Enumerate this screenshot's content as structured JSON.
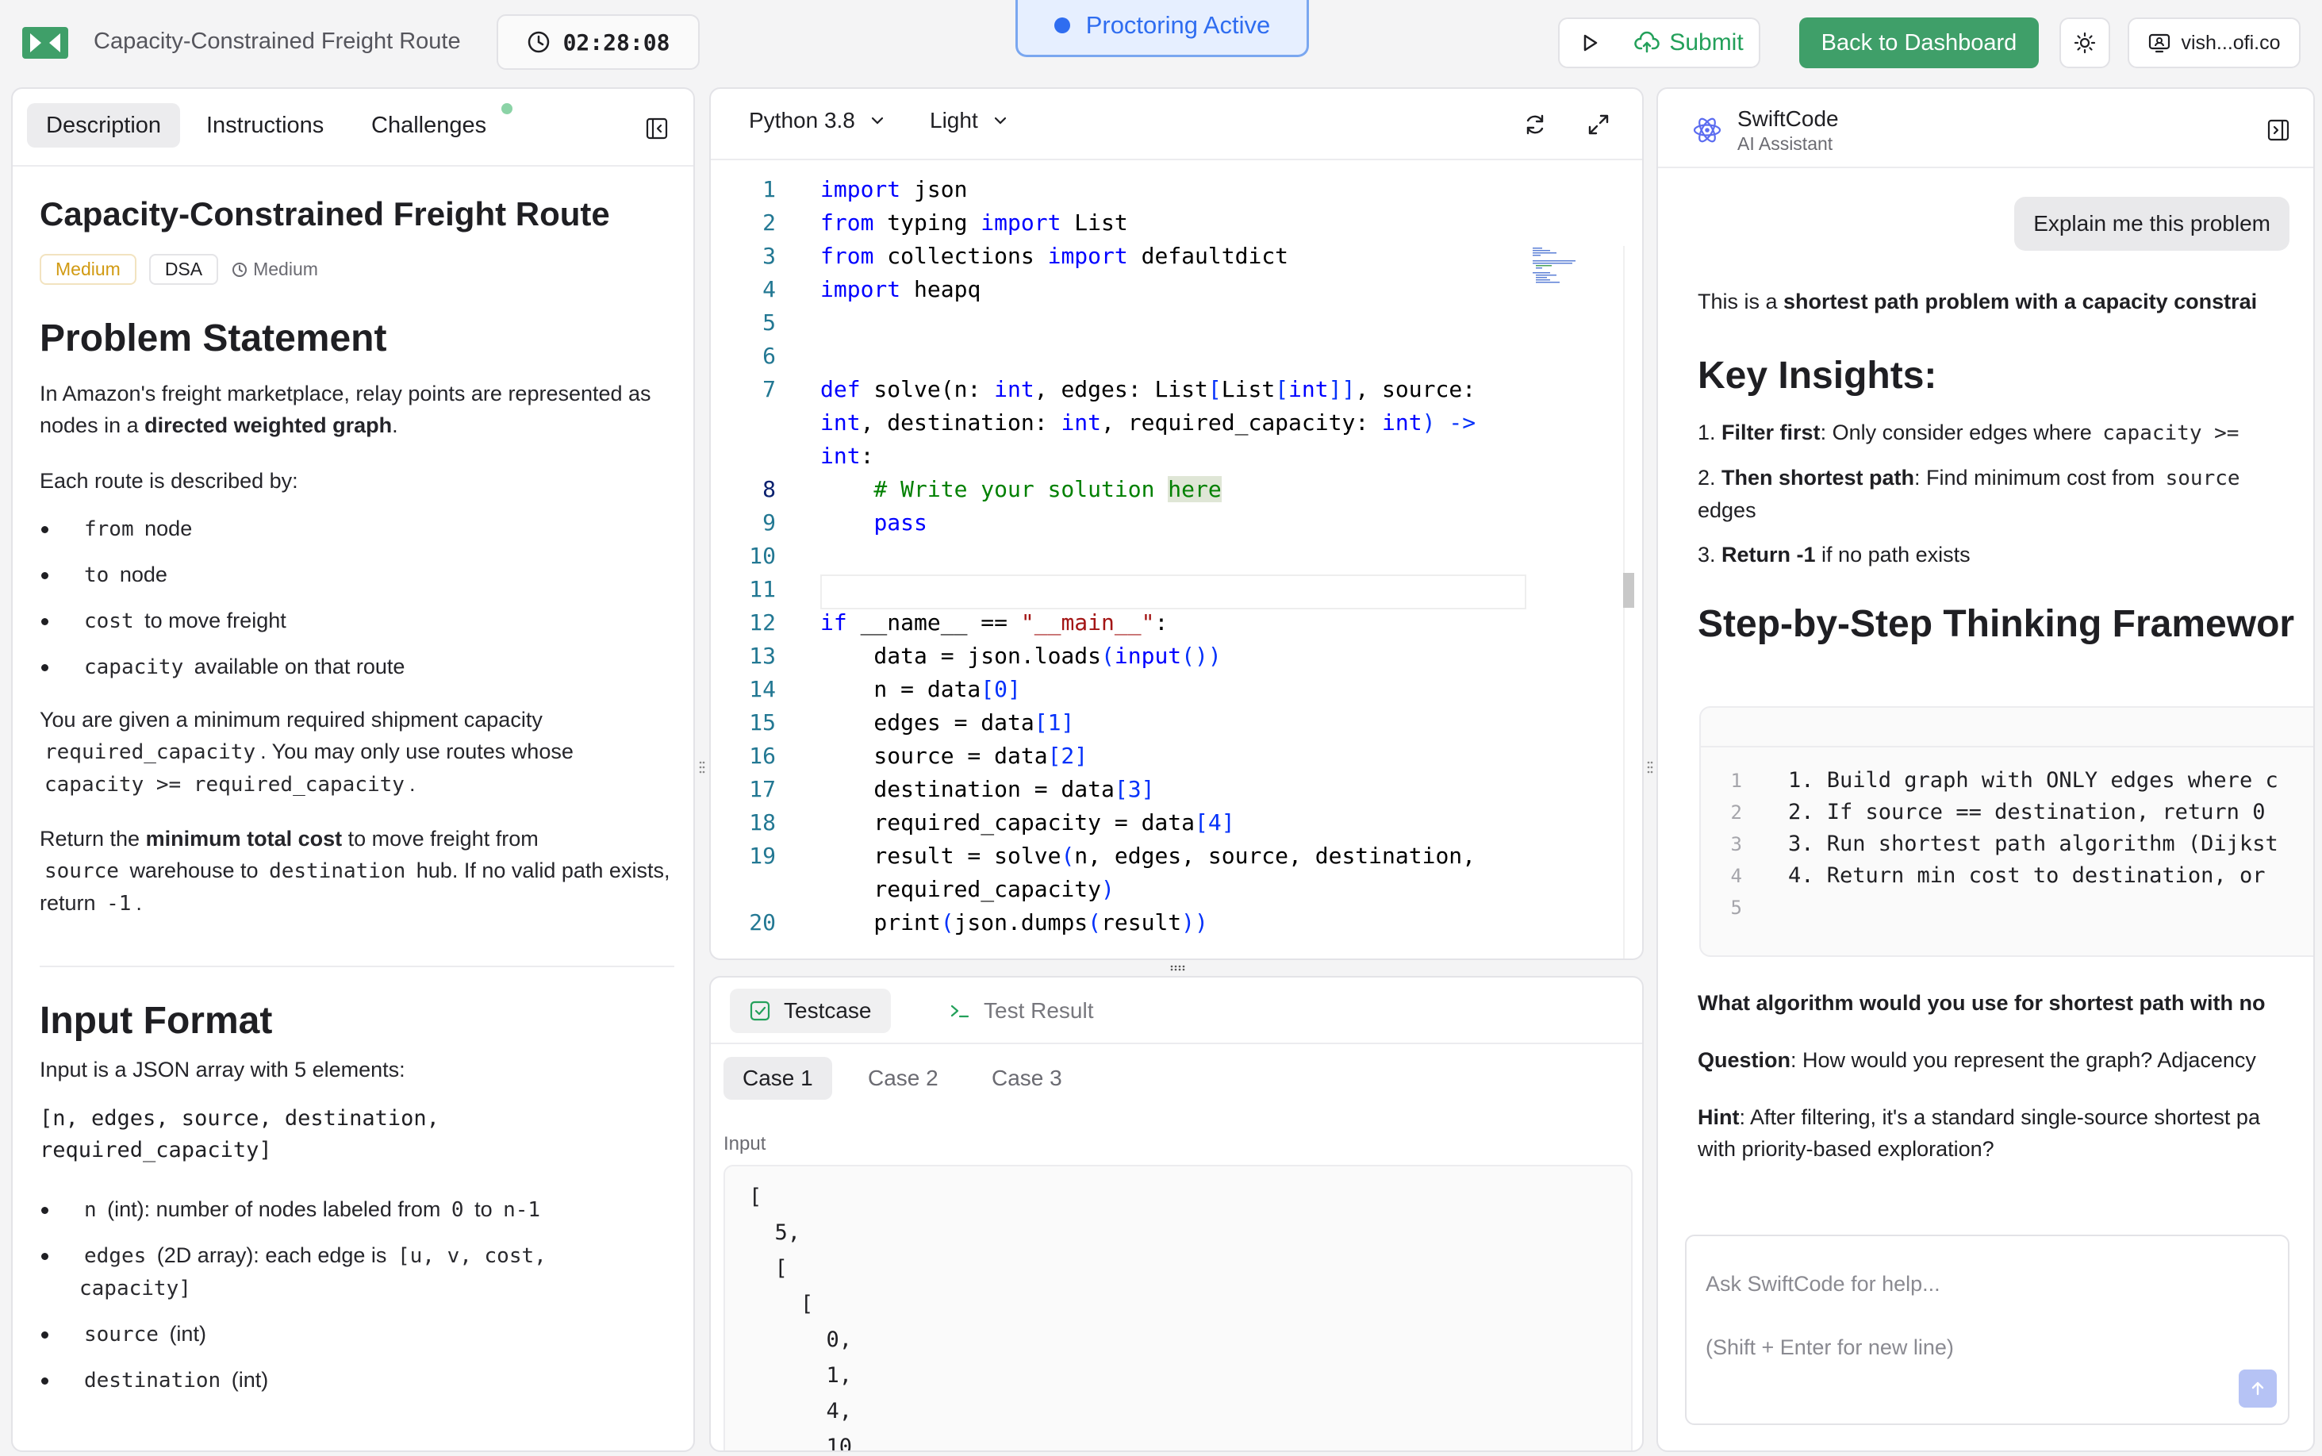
{
  "app": {
    "title": "Capacity-Constrained Freight Route",
    "timer": "02:28:08",
    "proctoring": "Proctoring Active",
    "submit": "Submit",
    "back": "Back to Dashboard",
    "user": "vish...ofi.co",
    "colors": {
      "accent_green": "#3f9f69",
      "proctor_blue": "#2f6df0"
    }
  },
  "left": {
    "tabs": {
      "description": "Description",
      "instructions": "Instructions",
      "challenges": "Challenges"
    },
    "title": "Capacity-Constrained Freight Route",
    "tag_difficulty": "Medium",
    "tag_type": "DSA",
    "tag_time": "Medium",
    "problem_heading": "Problem Statement",
    "intro_1": "In Amazon's freight marketplace, relay points are represented as nodes in a ",
    "intro_bold": "directed weighted graph",
    "intro_2": ".",
    "route_desc": "Each route is described by:",
    "route_items": [
      {
        "code": "from",
        "text": "node"
      },
      {
        "code": "to",
        "text": "node"
      },
      {
        "code": "cost",
        "text": "to move freight"
      },
      {
        "code": "capacity",
        "text": "available on that route"
      }
    ],
    "given_1": "You are given a minimum required shipment capacity",
    "given_code1": "required_capacity",
    "given_2": ". You may only use routes whose",
    "given_code2": "capacity >= required_capacity",
    "given_3": ".",
    "return_1": "Return the ",
    "return_bold": "minimum total cost",
    "return_2": " to move freight from",
    "return_code1": "source",
    "return_3": "warehouse to",
    "return_code2": "destination",
    "return_4": "hub. If no valid path exists, return",
    "return_code3": "-1",
    "return_5": ".",
    "input_heading": "Input Format",
    "input_desc": "Input is a JSON array with 5 elements:",
    "input_code": "[n, edges, source, destination,\nrequired_capacity]",
    "input_items": {
      "n_code": "n",
      "n_text": "(int): number of nodes labeled from",
      "n_from": "0",
      "n_to_word": "to",
      "n_to": "n-1",
      "edges_code": "edges",
      "edges_text": "(2D array): each edge is",
      "edges_fmt": "[u, v, cost,\ncapacity]",
      "source_code": "source",
      "source_text": "(int)",
      "dest_code": "destination",
      "dest_text": "(int)"
    }
  },
  "editor": {
    "language": "Python 3.8",
    "theme": "Light",
    "line_numbers": [
      "1",
      "2",
      "3",
      "4",
      "5",
      "6",
      "7",
      "",
      "",
      "8",
      "9",
      "10",
      "11",
      "12",
      "13",
      "14",
      "15",
      "16",
      "17",
      "18",
      "19",
      "",
      "20"
    ],
    "code": {
      "l1a": "import",
      "l1b": " json",
      "l2a": "from",
      "l2b": " typing ",
      "l2c": "import",
      "l2d": " List",
      "l3a": "from",
      "l3b": " collections ",
      "l3c": "import",
      "l3d": " defaultdict",
      "l4a": "import",
      "l4b": " heapq",
      "l7a": "def",
      "l7b": " solve(n: ",
      "l7c": "int",
      "l7d": ", edges: List",
      "l7e": "[",
      "l7f": "List",
      "l7g": "[",
      "l7h": "int",
      "l7i": "]]",
      "l7j": ", source:",
      "l7w1a": "int",
      "l7w1b": ", destination: ",
      "l7w1c": "int",
      "l7w1d": ", required_capacity: ",
      "l7w1e": "int",
      "l7w1f": ") ->",
      "l7w2a": "int",
      "l7w2b": ":",
      "l8a": "    # Write your solution ",
      "l8b": "here",
      "l9a": "    ",
      "l9b": "pass",
      "l12a": "if",
      "l12b": " __name__ ",
      "l12c": "==",
      "l12d": " ",
      "l12e": "\"__main__\"",
      "l12f": ":",
      "l13a": "    data = json.loads",
      "l13b": "(",
      "l13c": "input",
      "l13d": "())",
      "l14a": "    n = data",
      "l14b": "[0]",
      "l15a": "    edges = data",
      "l15b": "[1]",
      "l16a": "    source = data",
      "l16b": "[2]",
      "l17a": "    destination = data",
      "l17b": "[3]",
      "l18a": "    required_capacity = data",
      "l18b": "[4]",
      "l19a": "    result = solve",
      "l19b": "(",
      "l19c": "n, edges, source, destination,",
      "l19w1a": "    required_capacity",
      "l19w1b": ")",
      "l20a": "    print",
      "l20b": "(",
      "l20c": "json.dumps",
      "l20d": "(",
      "l20e": "result",
      "l20f": "))"
    }
  },
  "tests": {
    "tab_testcase": "Testcase",
    "tab_result": "Test Result",
    "cases": [
      "Case 1",
      "Case 2",
      "Case 3"
    ],
    "input_label": "Input",
    "input_value": "[\n  5,\n  [\n    [\n      0,\n      1,\n      4,\n      10"
  },
  "ai": {
    "name": "SwiftCode",
    "subtitle": "AI Assistant",
    "user_message": "Explain me this problem",
    "intro_1": "This is a ",
    "intro_bold": "shortest path problem with a capacity constrai",
    "insights_heading": "Key Insights:",
    "insight_1_num": "1. ",
    "insight_1_bold": "Filter first",
    "insight_1_text": ": Only consider edges where ",
    "insight_1_code": "capacity >=",
    "insight_2_num": "2. ",
    "insight_2_bold": "Then shortest path",
    "insight_2_text": ": Find minimum cost from ",
    "insight_2_code": "source",
    "insight_2_cont": "edges",
    "insight_3_num": "3. ",
    "insight_3_bold": "Return -1",
    "insight_3_text": " if no path exists",
    "framework_heading": "Step-by-Step Thinking Framewor",
    "steps": [
      {
        "n": "1",
        "text": "1. Build graph with ONLY edges where c"
      },
      {
        "n": "2",
        "text": "2. If source == destination, return 0"
      },
      {
        "n": "3",
        "text": "3. Run shortest path algorithm (Dijkst"
      },
      {
        "n": "4",
        "text": "4. Return min cost to destination, or"
      },
      {
        "n": "5",
        "text": ""
      }
    ],
    "q_bold": "What algorithm would you use for shortest path with no",
    "question_label": "Question",
    "question_text": ": How would you represent the graph? Adjacency",
    "hint_label": "Hint",
    "hint_text": ": After filtering, it's a standard single-source shortest pa",
    "hint_text_2": "with priority-based exploration?",
    "chat_placeholder": "Ask SwiftCode for help...\n(Shift + Enter for new line)"
  }
}
